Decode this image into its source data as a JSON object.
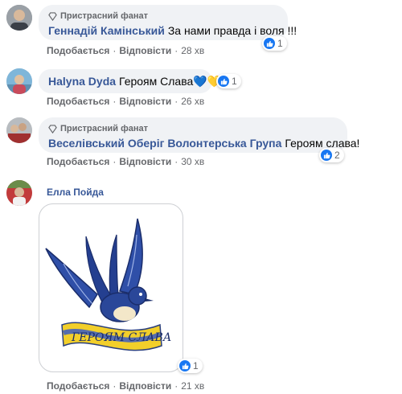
{
  "comments": [
    {
      "badge": "Пристрасний фанат",
      "author": "Геннадій Камінський",
      "text": "За нами правда і воля !!!",
      "like": "Подобається",
      "reply": "Відповісти",
      "time": "28 хв",
      "reactions": "1"
    },
    {
      "author": "Halyna Dyda",
      "text": "Героям Слава💙💛",
      "like": "Подобається",
      "reply": "Відповісти",
      "time": "26 хв",
      "reactions": "1"
    },
    {
      "badge": "Пристрасний фанат",
      "author": "Веселівський Оберіг Волонтерська Група",
      "text": "Героям слава!",
      "like": "Подобається",
      "reply": "Відповісти",
      "time": "30 хв",
      "reactions": "2"
    },
    {
      "author": "Елла Пойда",
      "image_caption": "ГЕРОЯМ СЛАВА",
      "like": "Подобається",
      "reply": "Відповісти",
      "time": "21 хв",
      "reactions": "1"
    }
  ],
  "colors": {
    "author": "#385898",
    "bubble": "#f0f2f5",
    "meta": "#65676b",
    "like_blue": "#1877f2",
    "swallow_blue": "#2f4fa8",
    "ribbon_yellow": "#f2cf2a"
  },
  "icons": [
    "diamond-icon",
    "like-icon"
  ]
}
